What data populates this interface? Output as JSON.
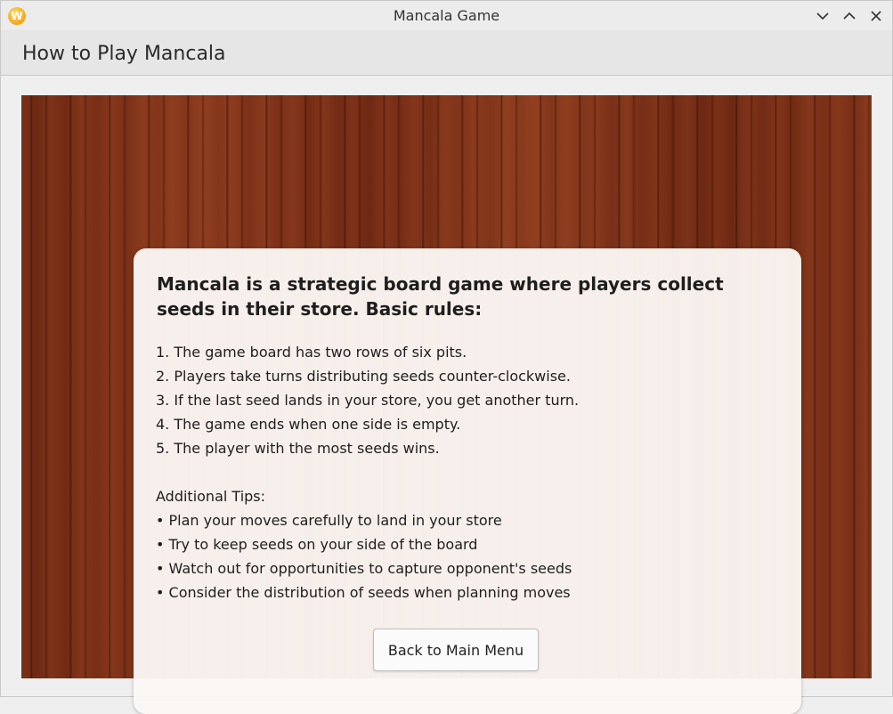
{
  "window": {
    "title": "Mancala Game",
    "icon": "app-logo-icon",
    "icon_letter": "W",
    "controls": [
      "minimize-icon",
      "maximize-icon",
      "close-icon"
    ]
  },
  "header": {
    "title": "How to Play Mancala"
  },
  "instructions": {
    "intro": "Mancala is a strategic board game where players collect seeds in their store. Basic rules:",
    "rules": [
      "1. The game board has two rows of six pits.",
      "2. Players take turns distributing seeds counter-clockwise.",
      "3. If the last seed lands in your store, you get another turn.",
      "4. The game ends when one side is empty.",
      "5. The player with the most seeds wins."
    ],
    "tips_heading": "Additional Tips:",
    "tips": [
      "Plan your moves carefully to land in your store",
      "Try to keep seeds on your side of the board",
      "Watch out for opportunities to capture opponent's seeds",
      "Consider the distribution of seeds when planning moves"
    ],
    "back_button_label": "Back to Main Menu"
  },
  "colors": {
    "wood_background": "#7a2f17",
    "card_background": "#fbf7f4",
    "app_icon": "#f0a81c"
  }
}
